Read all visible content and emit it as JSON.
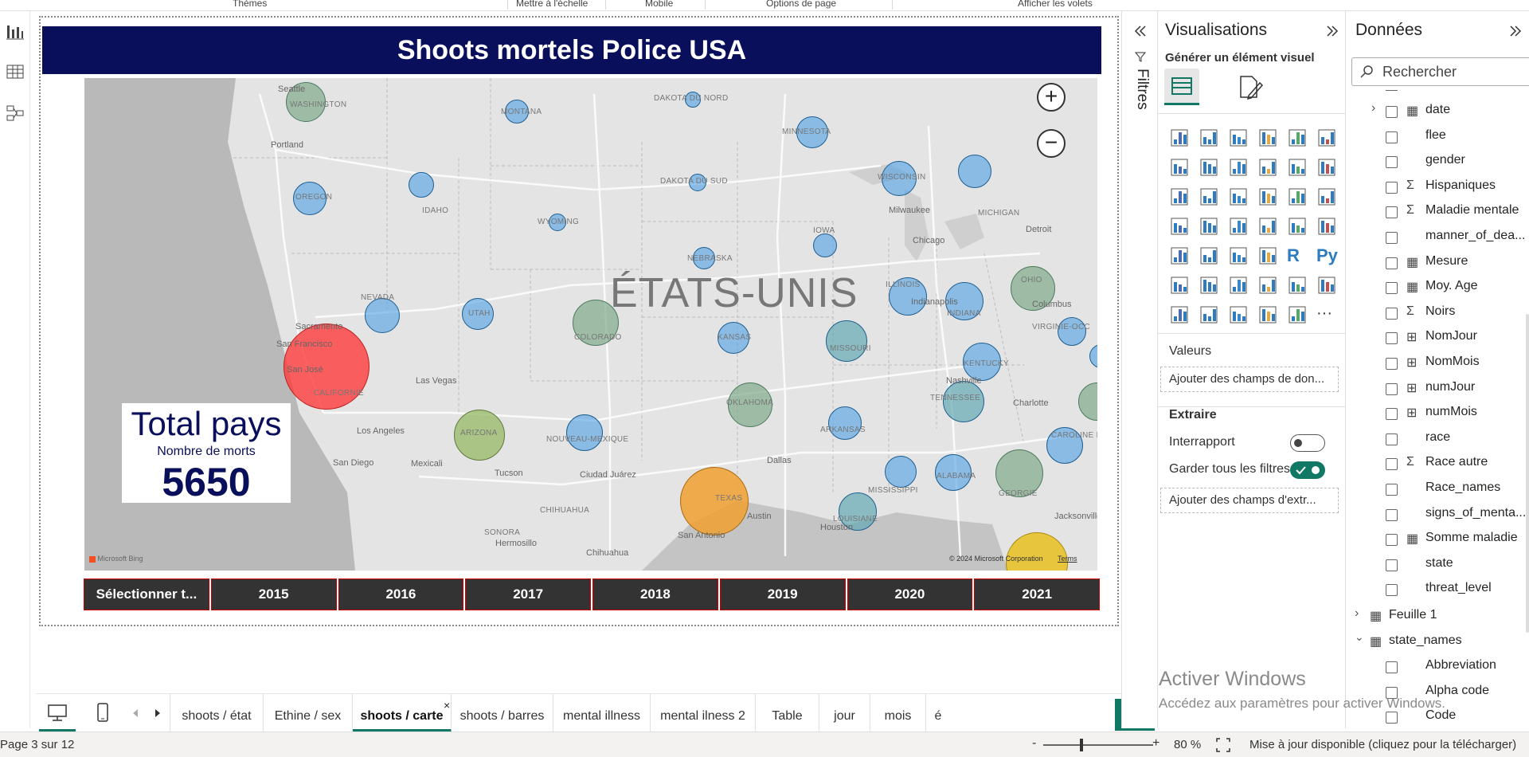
{
  "ribbon": {
    "items": [
      "Thèmes",
      "Mettre à l'échelle",
      "Mobile",
      "Options de page",
      "Afficher les volets"
    ]
  },
  "report": {
    "title": "Shoots mortels Police USA",
    "map": {
      "country_label": "ÉTATS-UNIS",
      "attribution": "© 2024 Microsoft Corporation",
      "terms": "Terms",
      "bing": "Microsoft Bing",
      "zoom_in": "+",
      "zoom_out": "−",
      "cities": [
        "Seattle",
        "Portland",
        "Sacramento",
        "San Francisco",
        "San José",
        "Las Vegas",
        "Los Angeles",
        "San Diego",
        "Mexicali",
        "Tucson",
        "Ciudad Juárez",
        "Chihuahua",
        "Hermosillo",
        "Dallas",
        "Austin",
        "San Antonio",
        "Houston",
        "Milwaukee",
        "Chicago",
        "Detroit",
        "Indianapolis",
        "Columbus",
        "Nashville",
        "Charlotte",
        "Jacksonville"
      ],
      "states": [
        "WASHINGTON",
        "MONTANA",
        "DAKOTA DU NORD",
        "MINNESOTA",
        "OREGON",
        "IDAHO",
        "DAKOTA DU SUD",
        "WISCONSIN",
        "MICHIGAN",
        "WYOMING",
        "IOWA",
        "NEBRASKA",
        "NEVADA",
        "UTAH",
        "COLORADO",
        "ILLINOIS",
        "INDIANA",
        "OHIO",
        "KANSAS",
        "MISSOURI",
        "KENTUCKY",
        "VIRGINIE-OCC",
        "CALIFORNIE",
        "ARIZONA",
        "NOUVEAU-MEXIQUE",
        "OKLAHOMA",
        "ARKANSAS",
        "TENNESSEE",
        "CAROLINE DU SUD",
        "ALABAMA",
        "MISSISSIPPI",
        "GEORGIE",
        "LOUISIANE",
        "TEXAS",
        "SONORA",
        "CHIHUAHUA"
      ]
    },
    "kpi": {
      "title": "Total pays",
      "subtitle": "Nombre de morts",
      "value": "5650"
    },
    "years": [
      "Sélectionner t...",
      "2015",
      "2016",
      "2017",
      "2018",
      "2019",
      "2020",
      "2021"
    ]
  },
  "tabs": [
    "shoots / état",
    "Ethine / sex",
    "shoots / carte",
    "shoots / barres",
    "mental illness",
    "mental ilness 2",
    "Table",
    "jour",
    "mois",
    "é"
  ],
  "active_tab": "shoots / carte",
  "status": {
    "page": "Page 3 sur 12",
    "zoom": "80 %",
    "update": "Mise à jour disponible (cliquez pour la télécharger)"
  },
  "filters_label": "Filtres",
  "viz": {
    "title": "Visualisations",
    "subtitle": "Générer un élément visuel",
    "values_label": "Valeurs",
    "values_drop": "Ajouter des champs de don...",
    "extract_label": "Extraire",
    "cross_report": "Interrapport",
    "keep_filters": "Garder tous les filtres",
    "extract_drop": "Ajouter des champs d'extr...",
    "r_label": "R",
    "py_label": "Py",
    "more": "···"
  },
  "data_pane": {
    "title": "Données",
    "search_placeholder": "Rechercher",
    "fields": [
      "date",
      "flee",
      "gender",
      "Hispaniques",
      "Maladie mentale",
      "manner_of_dea...",
      "Mesure",
      "Moy. Age",
      "Noirs",
      "NomJour",
      "NomMois",
      "numJour",
      "numMois",
      "race",
      "Race autre",
      "Race_names",
      "signs_of_menta...",
      "Somme maladie",
      "state",
      "threat_level"
    ],
    "tables": [
      "Feuille 1",
      "state_names"
    ],
    "state_fields": [
      "Abbreviation",
      "Alpha code",
      "Code"
    ]
  },
  "watermark": {
    "line1": "Activer Windows",
    "line2": "Accédez aux paramètres pour activer Windows."
  },
  "colors": {
    "accent": "#117865",
    "title_bg": "#0a0f5c",
    "bubble_blue": "#4ca0e6",
    "bubble_red": "#ff3b3b",
    "bubble_green": "#7fa98a",
    "bubble_orange": "#f0a030",
    "bubble_yellow": "#e8c020"
  }
}
